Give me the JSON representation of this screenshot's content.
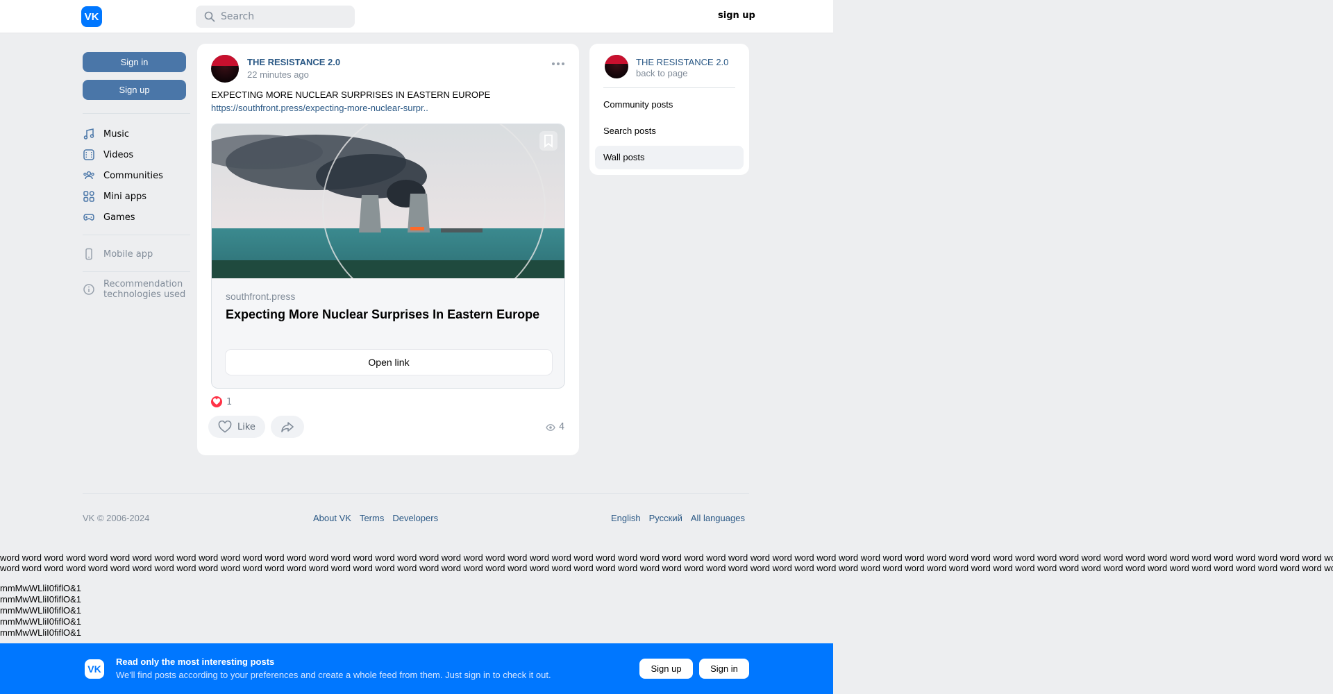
{
  "header": {
    "logo_text": "VK",
    "search_placeholder": "Search",
    "signup_label": "sign up"
  },
  "sidebar": {
    "signin_label": "Sign in",
    "signup_label": "Sign up",
    "items": [
      {
        "label": "Music",
        "icon": "music-icon"
      },
      {
        "label": "Videos",
        "icon": "video-icon"
      },
      {
        "label": "Communities",
        "icon": "communities-icon"
      },
      {
        "label": "Mini apps",
        "icon": "mini-apps-icon"
      },
      {
        "label": "Games",
        "icon": "gamepad-icon"
      }
    ],
    "mobile_app_label": "Mobile app",
    "recommendation_line1": "Recommendation",
    "recommendation_line2": "technologies used"
  },
  "post": {
    "author": "THE RESISTANCE 2.0",
    "time": "22 minutes ago",
    "text": "EXPECTING MORE NUCLEAR SURPRISES IN EASTERN EUROPE",
    "link": "https://southfront.press/expecting-more-nuclear-surpr..",
    "card": {
      "domain": "southfront.press",
      "title": "Expecting More Nuclear Surprises In Eastern Europe",
      "open_label": "Open link"
    },
    "reactions_count": "1",
    "like_label": "Like",
    "views_count": "4"
  },
  "right_panel": {
    "name": "THE RESISTANCE 2.0",
    "back_label": "back to page",
    "items": [
      "Community posts",
      "Search posts",
      "Wall posts"
    ],
    "active_index": 2
  },
  "footer": {
    "copyright": "VK © 2006-2024",
    "links": [
      "About VK",
      "Terms",
      "Developers"
    ],
    "languages": [
      "English",
      "Русский",
      "All languages"
    ]
  },
  "word_text": "word word word word word word word word word word word word word word word word word word word word word word word word word word word word word word word word word word word word word word word word word word word word word word word word word word word word word word word word word word word word word word word word word word word word word",
  "mm_lines": [
    "mmMwWLliI0fiflO&1",
    "mmMwWLliI0fiflO&1",
    "mmMwWLliI0fiflO&1",
    "mmMwWLliI0fiflO&1",
    "mmMwWLliI0fiflO&1"
  ],
  "banner": {
    "logo_text": "VK",
    "title": "Read only the most interesting posts",
    "subtitle": "We'll find posts according to your preferences and create a whole feed from them. Just sign in to check it out.",
    "signup_label": "Sign up",
    "signin_label": "Sign in"
  },
  "colors": {
    "accent": "#0077ff",
    "button": "#4a76a8",
    "link": "#2a5885",
    "like": "#ff3347"
  }
}
